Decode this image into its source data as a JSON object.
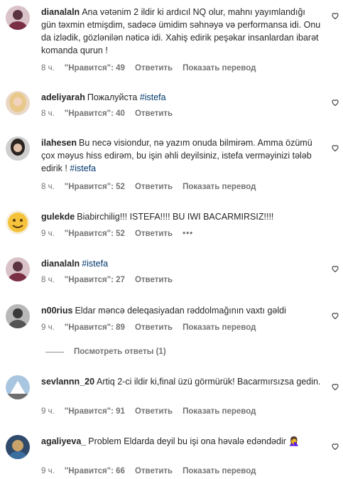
{
  "comments": [
    {
      "username": "dianalaln",
      "text": "Ana vətənim 2 ildir ki ardıcıl NQ olur, mahnı yayımlandığı gün təxmin etmişdim, sadəcə ümidim səhnəyə və performansa idi. Onu da izlədik, gözlənilən nəticə idi. Xahiş edirik peşəkar insanlardan ibarət komanda qurun !",
      "tag": "",
      "time": "8 ч.",
      "likes": "\"Нравится\": 49",
      "reply": "Ответить",
      "translate": "Показать перевод"
    },
    {
      "username": "adeliyarah",
      "text": "Пожалуйста ",
      "tag": "#istefa",
      "time": "8 ч.",
      "likes": "\"Нравится\": 40",
      "reply": "Ответить",
      "translate": ""
    },
    {
      "username": "ilahesen",
      "text": "Bu necə visiondur, nə yazım onuda bilmirəm. Amma özümü çox məyus hiss edirəm, bu işin əhli deyilsiniz, istefa verməyinizi tələb edirik ! ",
      "tag": "#istefa",
      "time": "8 ч.",
      "likes": "\"Нравится\": 52",
      "reply": "Ответить",
      "translate": "Показать перевод"
    },
    {
      "username": "gulekde",
      "text": "Biabirchilig!!! ISTEFA!!!! BU IWI BACARMIRSIZ!!!!",
      "tag": "",
      "time": "9 ч.",
      "likes": "\"Нравится\": 52",
      "reply": "Ответить",
      "translate": ""
    },
    {
      "username": "dianalaln",
      "text": "",
      "tag": "#istefa",
      "time": "8 ч.",
      "likes": "\"Нравится\": 27",
      "reply": "Ответить",
      "translate": ""
    },
    {
      "username": "n00rius",
      "text": "Eldar məncə deleqasiyadan rəddolmağının vaxtı gəldi",
      "tag": "",
      "time": "9 ч.",
      "likes": "\"Нравится\": 89",
      "reply": "Ответить",
      "translate": "Показать перевод"
    },
    {
      "username": "sevlannn_20",
      "text": "Artiq 2-ci ildir ki,final üzü görmürük! Bacarmırsızsa gedin.",
      "tag": "",
      "time": "9 ч.",
      "likes": "\"Нравится\": 91",
      "reply": "Ответить",
      "translate": "Показать перевод"
    },
    {
      "username": "agaliyeva_",
      "text": "Problem Eldarda deyil bu işi ona həvalə edəndədir ",
      "tag": "",
      "emoji": "🤦‍♀️",
      "time": "9 ч.",
      "likes": "\"Нравится\": 66",
      "reply": "Ответить",
      "translate": "Показать перевод"
    }
  ],
  "thread": {
    "label": "Посмотреть ответы (1)"
  },
  "more_dots": "•••",
  "colors": {
    "hashtag": "#00376b",
    "meta": "#737373",
    "text": "#262626"
  }
}
